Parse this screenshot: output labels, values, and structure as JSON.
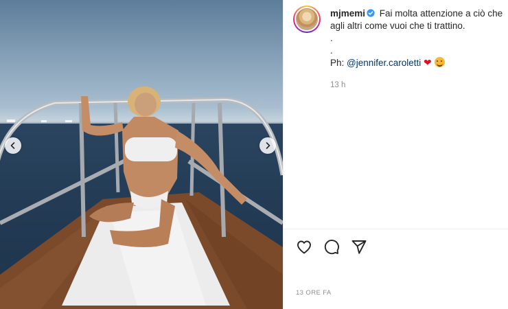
{
  "post": {
    "username": "mjmemi",
    "caption_line1": "Fai molta attenzione a ciò che agli altri come vuoi che ti trattino.",
    "caption_dot1": ".",
    "caption_dot2": ".",
    "credit_prefix": "Ph: ",
    "mention": "@jennifer.caroletti",
    "time_ago": "13 h",
    "time_full": "13 ORE FA"
  },
  "icons": {
    "verified": "verified-badge-icon",
    "like": "heart-icon",
    "comment": "comment-icon",
    "share": "paper-plane-icon",
    "prev": "chevron-left-icon",
    "next": "chevron-right-icon"
  },
  "colors": {
    "verified_blue": "#3897f0",
    "mention": "#00376b",
    "muted_text": "#8e8e8e",
    "heart_emoji": "#e0102b"
  }
}
